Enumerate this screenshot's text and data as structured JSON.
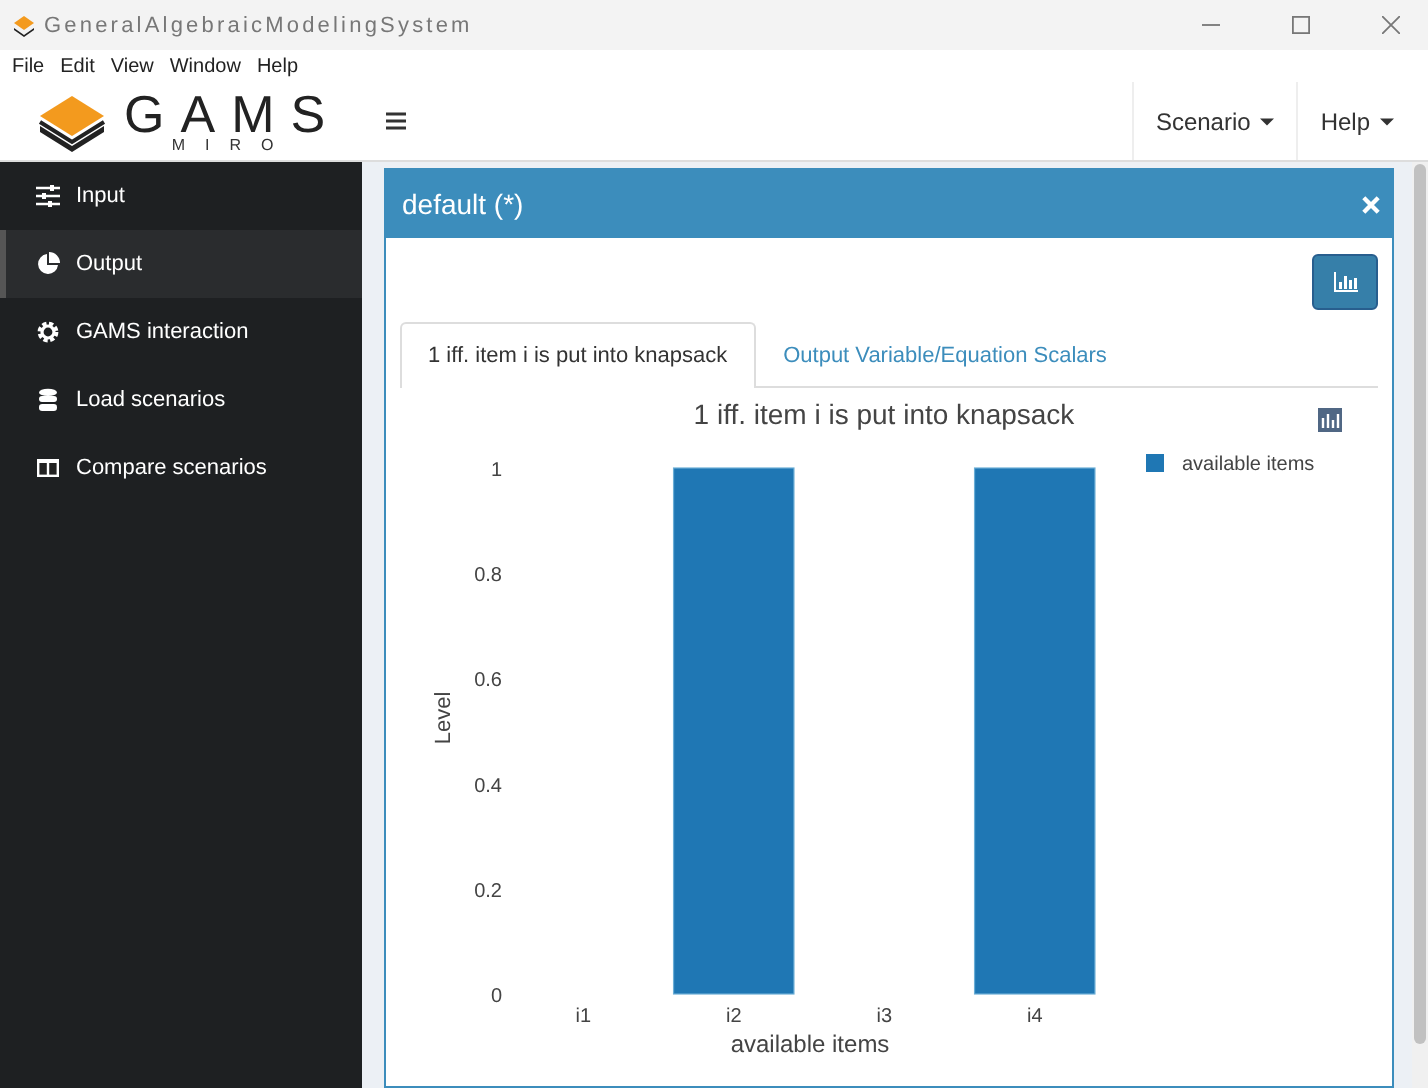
{
  "window": {
    "title": "GeneralAlgebraicModelingSystem"
  },
  "menu": [
    "File",
    "Edit",
    "View",
    "Window",
    "Help"
  ],
  "logo": {
    "name": "GAMS",
    "sub": "MIRO"
  },
  "nav": [
    {
      "label": "Scenario"
    },
    {
      "label": "Help"
    }
  ],
  "sidebar": {
    "items": [
      {
        "label": "Input",
        "selected": false
      },
      {
        "label": "Output",
        "selected": true
      },
      {
        "label": "GAMS interaction",
        "selected": false
      },
      {
        "label": "Load scenarios",
        "selected": false
      },
      {
        "label": "Compare scenarios",
        "selected": false
      }
    ]
  },
  "panel": {
    "title": "default (*)",
    "tabs": [
      {
        "label": "1 iff. item i is put into knapsack",
        "selected": true
      },
      {
        "label": "Output Variable/Equation Scalars",
        "selected": false
      }
    ],
    "chart_data": {
      "type": "bar",
      "title": "1 iff. item i is put into knapsack",
      "xlabel": "available items",
      "ylabel": "Level",
      "categories": [
        "i1",
        "i2",
        "i3",
        "i4"
      ],
      "series": [
        {
          "name": "available items",
          "color": "#1f77b4",
          "values": [
            0,
            1,
            0,
            1
          ]
        }
      ],
      "ylim": [
        0,
        1
      ],
      "yticks": [
        0,
        0.2,
        0.4,
        0.6,
        0.8,
        1
      ]
    }
  }
}
